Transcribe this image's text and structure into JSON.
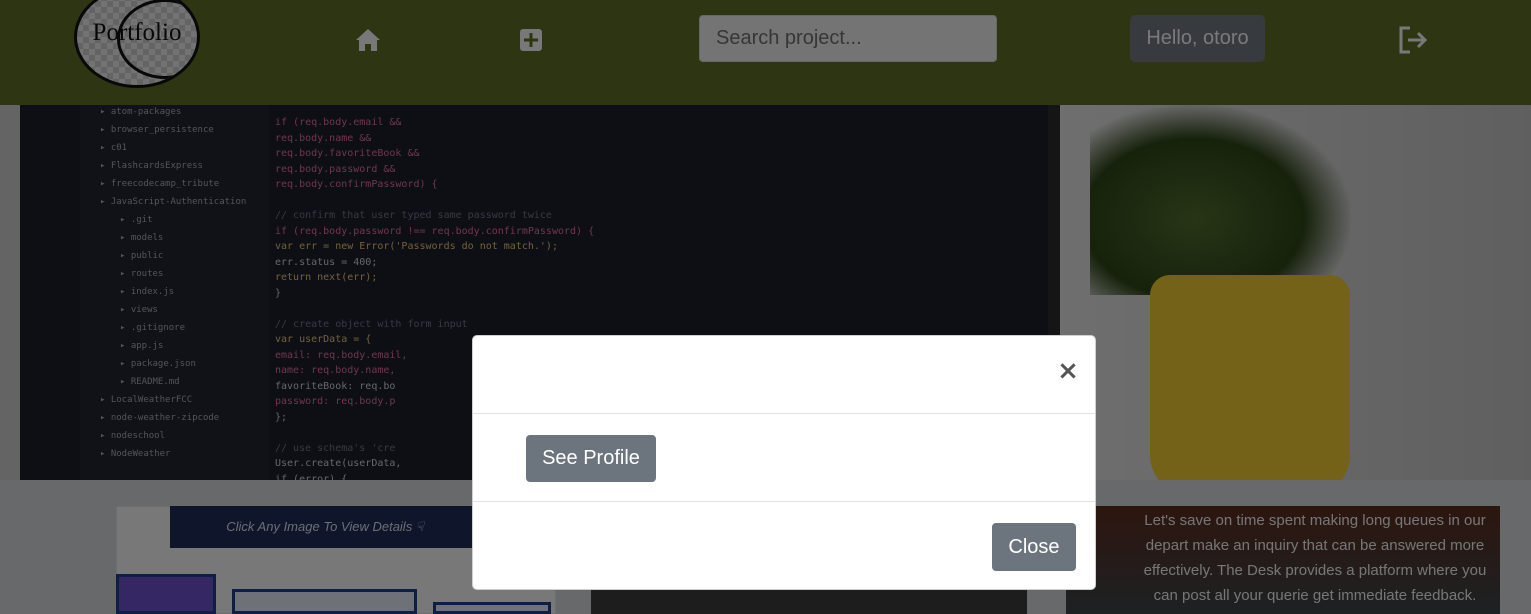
{
  "navbar": {
    "logo_text": "Portfolio",
    "home_icon": "home-icon",
    "add_icon": "plus-square-icon",
    "search_placeholder": "Search project...",
    "greeting": "Hello, otoro",
    "logout_icon": "logout-icon"
  },
  "hero": {
    "file_tree": [
      "atom-packages",
      "browser_persistence",
      "c01",
      "FlashcardsExpress",
      "freecodecamp_tribute",
      "JavaScript-Authentication",
      ".git",
      "models",
      "public",
      "routes",
      "index.js",
      "views",
      ".gitignore",
      "app.js",
      "package.json",
      "README.md",
      "LocalWeatherFCC",
      "node-weather-zipcode",
      "nodeschool",
      "NodeWeather"
    ],
    "code_lines": [
      "if (req.body.email &&",
      "  req.body.name &&",
      "  req.body.favoriteBook &&",
      "  req.body.password &&",
      "  req.body.confirmPassword) {",
      "",
      "  // confirm that user typed same password twice",
      "  if (req.body.password !== req.body.confirmPassword) {",
      "    var err = new Error('Passwords do not match.');",
      "    err.status = 400;",
      "    return next(err);",
      "  }",
      "",
      "  // create object with form input",
      "  var userData = {",
      "    email: req.body.email,",
      "    name: req.body.name,",
      "    favoriteBook: req.bo",
      "    password: req.body.p",
      "  };",
      "",
      "  // use schema's 'cre",
      "  User.create(userData,",
      "    if (error) {"
    ]
  },
  "content": {
    "click_banner": "Click Any Image To View Details ☟",
    "right_card_text": "Let's save on time spent making long queues in our depart make an inquiry that can be answered more effectively. The Desk provides a platform where you can post all your querie get immediate feedback."
  },
  "modal": {
    "close_x": "×",
    "see_profile_label": "See Profile",
    "close_label": "Close"
  },
  "colors": {
    "navbar_bg": "#5b6b24",
    "button_secondary": "#6c757d",
    "overlay": "rgba(0,0,0,0.5)"
  }
}
